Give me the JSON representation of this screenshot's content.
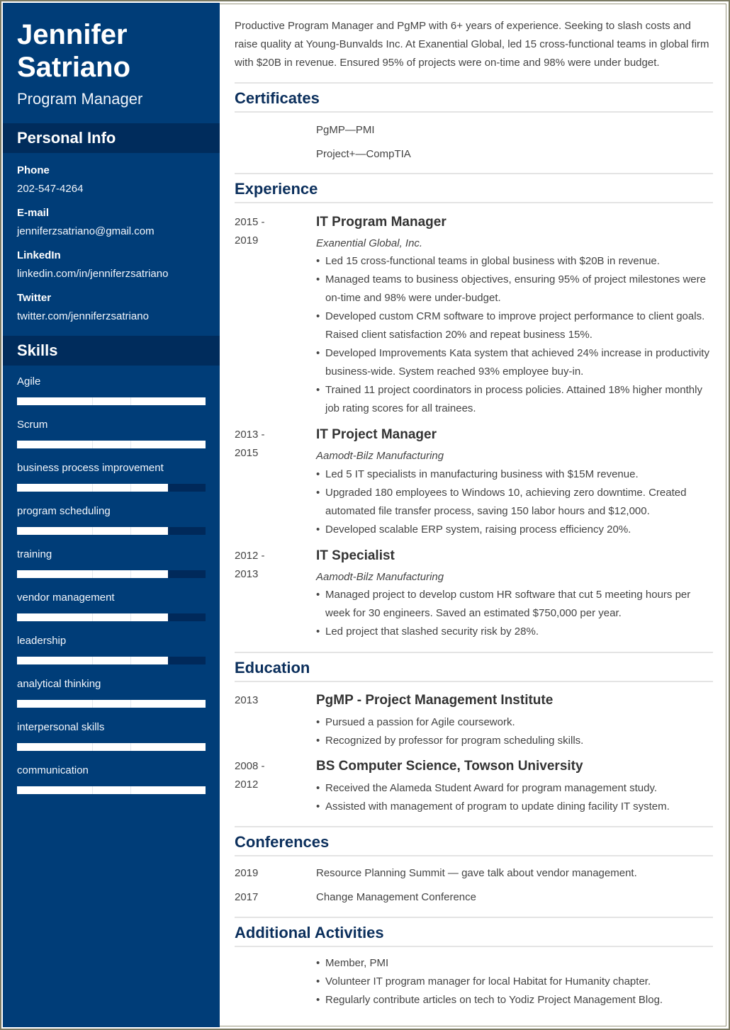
{
  "profile": {
    "first_name": "Jennifer",
    "last_name": "Satriano",
    "title": "Program Manager"
  },
  "sidebar": {
    "personal_info_heading": "Personal Info",
    "personal_info": [
      {
        "label": "Phone",
        "value": "202-547-4264"
      },
      {
        "label": "E-mail",
        "value": "jenniferzsatriano@gmail.com"
      },
      {
        "label": "LinkedIn",
        "value": "linkedin.com/in/jenniferzsatriano"
      },
      {
        "label": "Twitter",
        "value": "twitter.com/jenniferzsatriano"
      }
    ],
    "skills_heading": "Skills",
    "skills": [
      {
        "name": "Agile",
        "level": 1.0
      },
      {
        "name": "Scrum",
        "level": 1.0
      },
      {
        "name": "business process improvement",
        "level": 0.8
      },
      {
        "name": "program scheduling",
        "level": 0.8
      },
      {
        "name": "training",
        "level": 0.8
      },
      {
        "name": "vendor management",
        "level": 0.8
      },
      {
        "name": "leadership",
        "level": 0.8
      },
      {
        "name": "analytical thinking",
        "level": 1.0
      },
      {
        "name": "interpersonal skills",
        "level": 1.0
      },
      {
        "name": "communication",
        "level": 1.0
      }
    ]
  },
  "summary": "Productive Program Manager and PgMP with 6+ years of experience. Seeking to slash costs and raise quality at Young-Bunvalds Inc. At Exanential Global, led 15 cross-functional teams in global firm with $20B in revenue. Ensured 95% of projects were on-time and 98% were under budget.",
  "certificates": {
    "heading": "Certificates",
    "items": [
      "PgMP—PMI",
      "Project+—CompTIA"
    ]
  },
  "experience": {
    "heading": "Experience",
    "jobs": [
      {
        "date_start": "2015 -",
        "date_end": "2019",
        "title": "IT Program Manager",
        "company": "Exanential Global, Inc.",
        "bullets": [
          "Led 15 cross-functional teams in global business with $20B in revenue.",
          "Managed teams to business objectives, ensuring 95% of project milestones were on-time and 98% were under-budget.",
          "Developed custom CRM software to improve project performance to client goals. Raised client satisfaction 20% and repeat business 15%.",
          "Developed Improvements Kata system that achieved 24% increase in productivity business-wide. System reached 93% employee buy-in.",
          "Trained 11 project coordinators in process policies. Attained 18% higher monthly job rating scores for all trainees."
        ]
      },
      {
        "date_start": "2013 -",
        "date_end": "2015",
        "title": "IT Project Manager",
        "company": "Aamodt-Bilz Manufacturing",
        "bullets": [
          "Led 5 IT specialists in manufacturing business with $15M revenue.",
          "Upgraded 180 employees to Windows 10, achieving zero downtime. Created automated file transfer process, saving 150 labor hours and $12,000.",
          "Developed scalable ERP system, raising process efficiency 20%."
        ]
      },
      {
        "date_start": "2012 -",
        "date_end": "2013",
        "title": "IT Specialist",
        "company": "Aamodt-Bilz Manufacturing",
        "bullets": [
          "Managed project to develop custom HR software that cut 5 meeting hours per week for 30 engineers. Saved an estimated $750,000 per year.",
          "Led project that slashed security risk by 28%."
        ]
      }
    ]
  },
  "education": {
    "heading": "Education",
    "items": [
      {
        "date_start": "2013",
        "date_end": "",
        "title": "PgMP - Project Management Institute",
        "bullets": [
          "Pursued a passion for Agile coursework.",
          "Recognized by professor for program scheduling skills."
        ]
      },
      {
        "date_start": "2008 -",
        "date_end": "2012",
        "title": "BS Computer Science, Towson University",
        "bullets": [
          "Received the Alameda Student Award for program management study.",
          "Assisted with management of program to update dining facility IT system."
        ]
      }
    ]
  },
  "conferences": {
    "heading": "Conferences",
    "items": [
      {
        "year": "2019",
        "text": "Resource Planning Summit — gave talk about vendor management."
      },
      {
        "year": "2017",
        "text": "Change Management Conference"
      }
    ]
  },
  "activities": {
    "heading": "Additional Activities",
    "items": [
      "Member, PMI",
      "Volunteer IT program manager for local Habitat for Humanity chapter.",
      "Regularly contribute articles on tech to Yodiz Project Management Blog."
    ]
  },
  "colors": {
    "sidebar_bg": "#003d78",
    "sidebar_heading_bg": "#002c5c",
    "section_title": "#0b2f5c",
    "body_text": "#444444"
  }
}
